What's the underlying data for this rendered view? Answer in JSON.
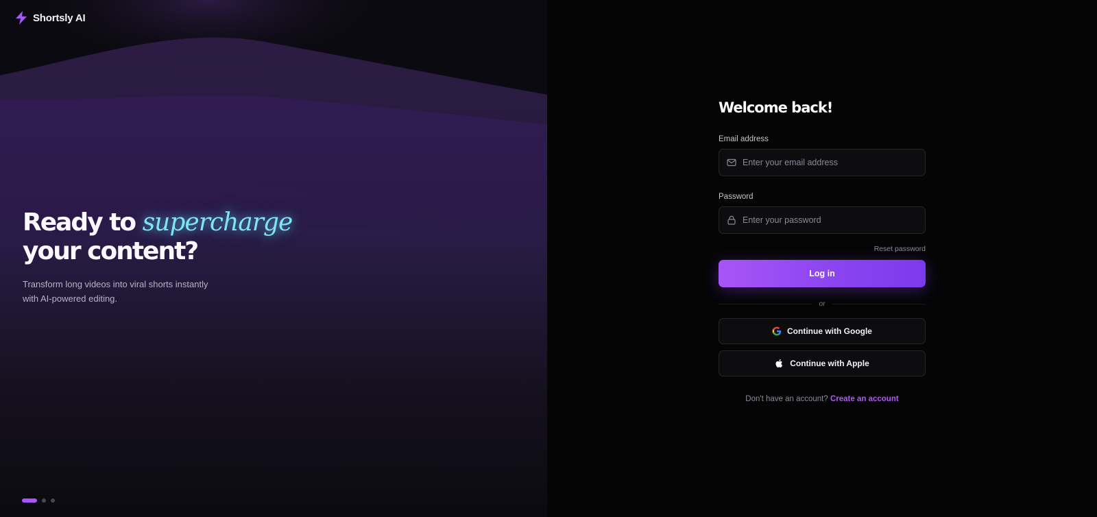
{
  "brand": {
    "name": "Shortsly AI",
    "icon": "lightning-bolt-icon",
    "color": "#a855f7"
  },
  "hero": {
    "headline_prefix": "Ready to",
    "headline_accent": "supercharge",
    "headline_suffix": "your content?",
    "subtext": "Transform long videos into viral shorts instantly with AI-powered editing.",
    "accent_color": "#7fe4f5",
    "carousel": {
      "total": 3,
      "active": 1
    }
  },
  "form": {
    "title": "Welcome back!",
    "email": {
      "label": "Email address",
      "placeholder": "Enter your email address",
      "value": "",
      "icon": "mail-icon"
    },
    "password": {
      "label": "Password",
      "placeholder": "Enter your password",
      "value": "",
      "icon": "lock-icon"
    },
    "reset_label": "Reset password",
    "login_label": "Log in",
    "divider_label": "or",
    "google_label": "Continue with Google",
    "apple_label": "Continue with Apple",
    "signup_prompt": "Don't have an account?",
    "signup_link": "Create an account",
    "primary_color": "#a855f7"
  }
}
